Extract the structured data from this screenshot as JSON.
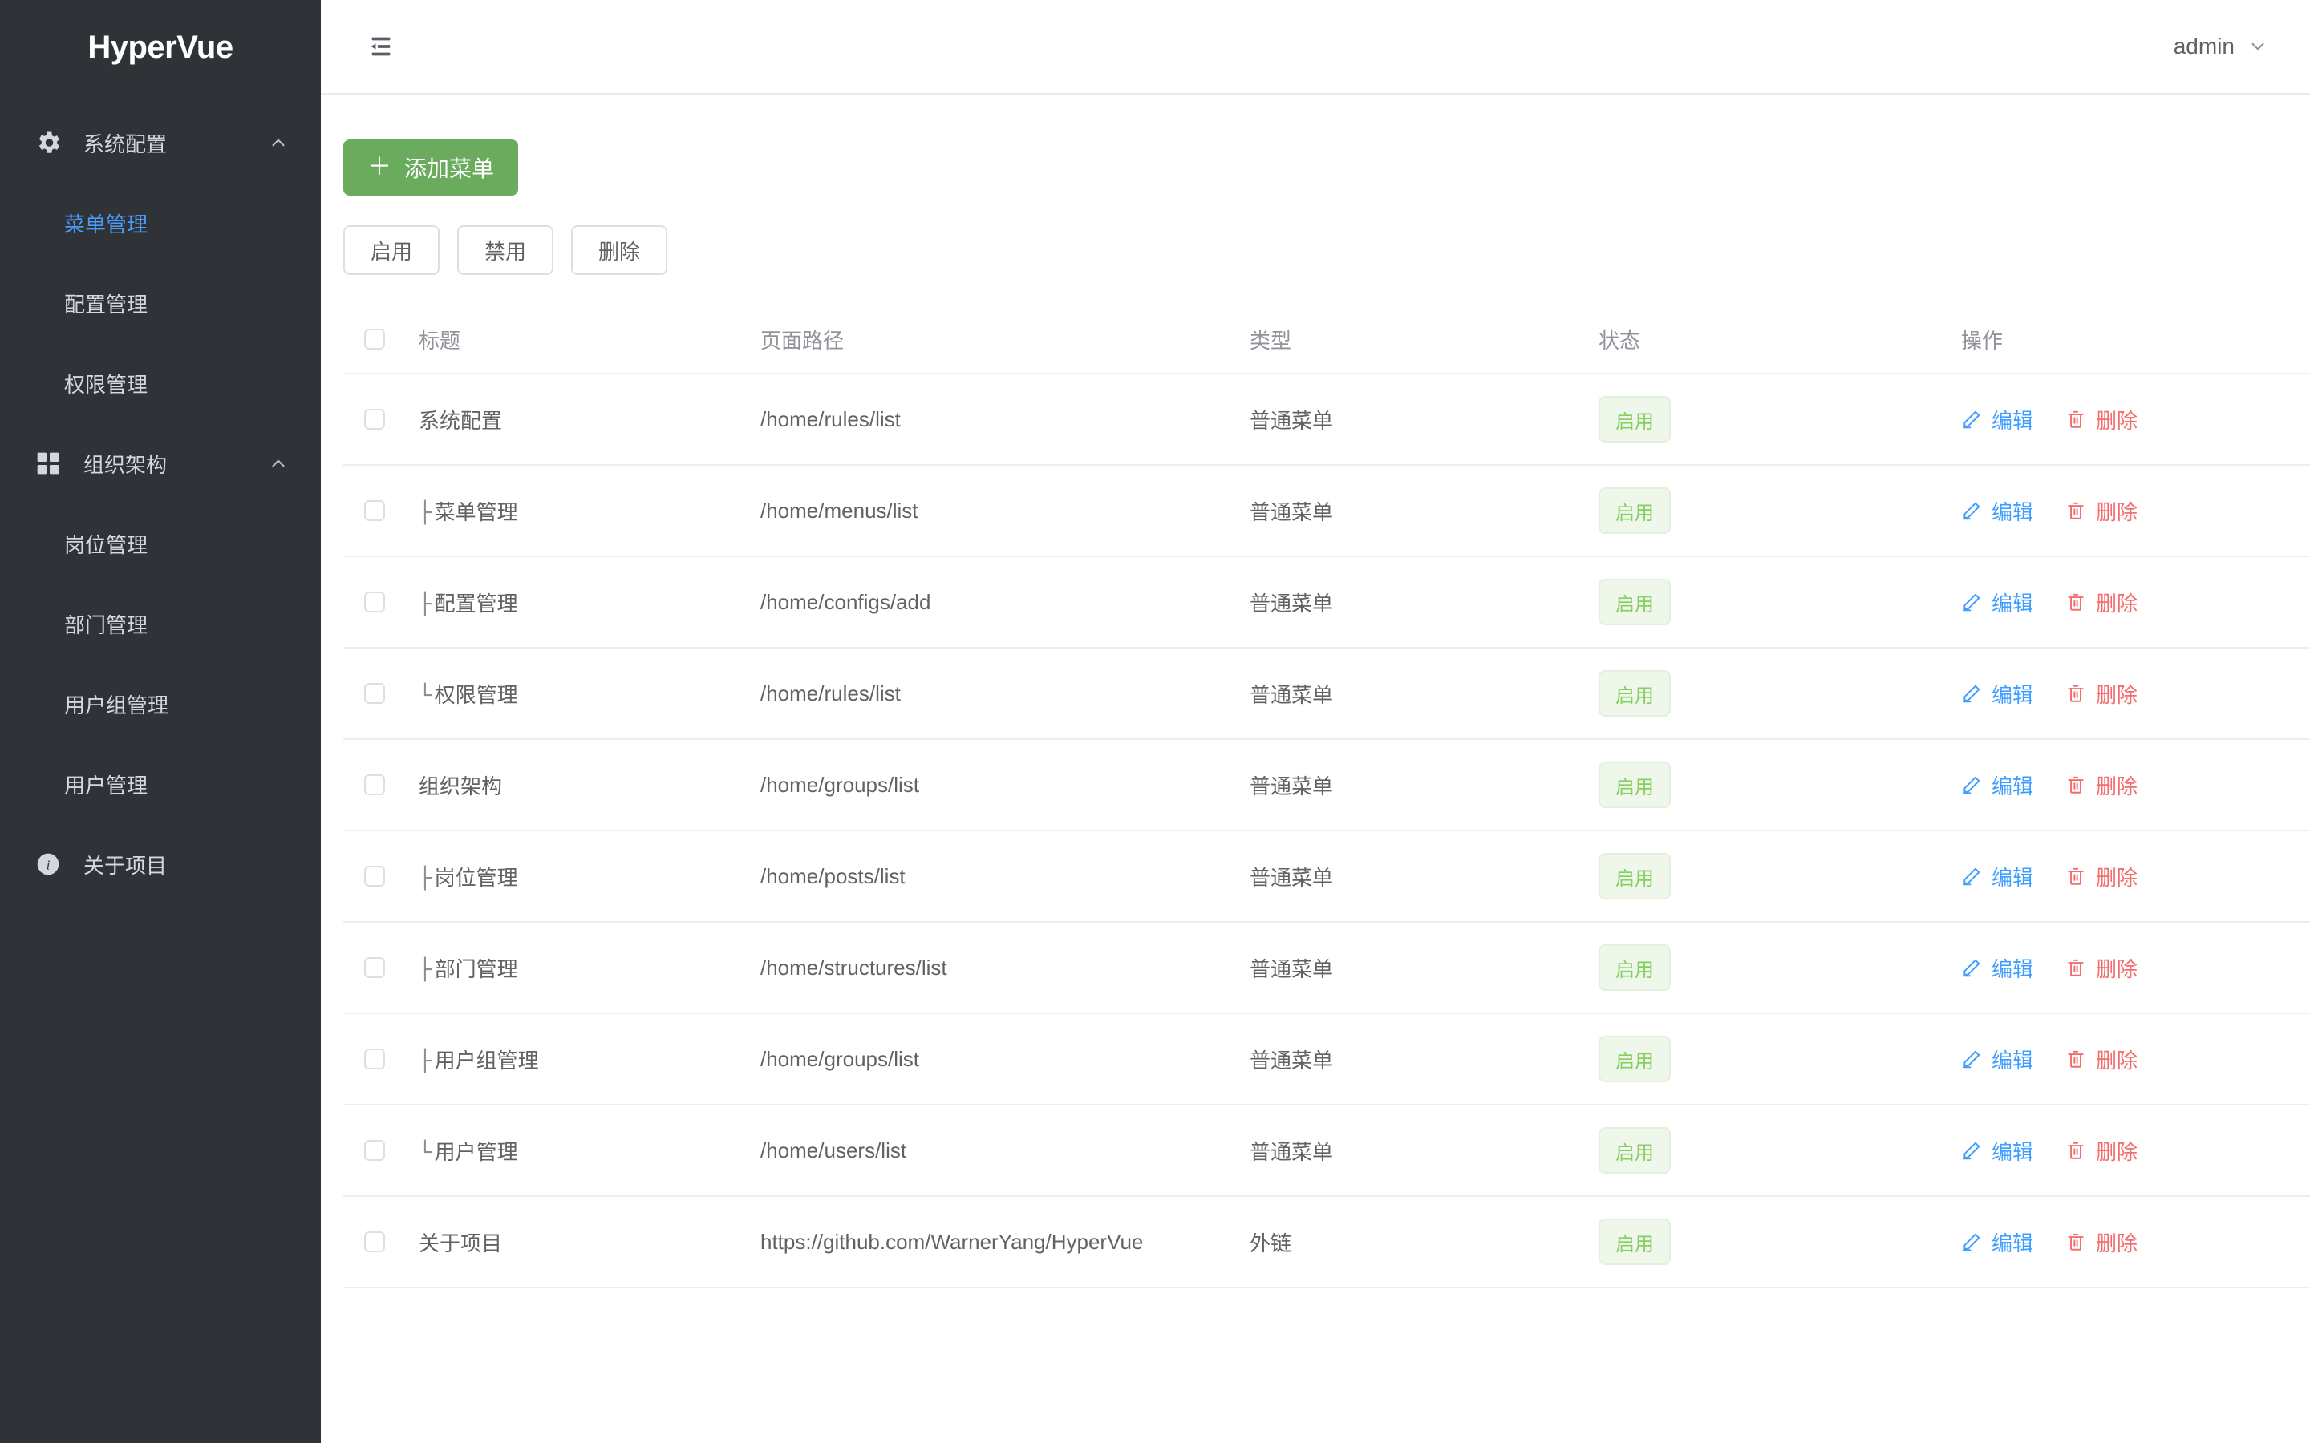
{
  "app": {
    "brand": "HyperVue"
  },
  "sidebar": {
    "groups": [
      {
        "label": "系统配置",
        "icon": "gear-icon",
        "expanded": true,
        "items": [
          {
            "label": "菜单管理",
            "active": true
          },
          {
            "label": "配置管理",
            "active": false
          },
          {
            "label": "权限管理",
            "active": false
          }
        ]
      },
      {
        "label": "组织架构",
        "icon": "grid-icon",
        "expanded": true,
        "items": [
          {
            "label": "岗位管理",
            "active": false
          },
          {
            "label": "部门管理",
            "active": false
          },
          {
            "label": "用户组管理",
            "active": false
          },
          {
            "label": "用户管理",
            "active": false
          }
        ]
      }
    ],
    "single": [
      {
        "label": "关于项目",
        "icon": "info-icon"
      }
    ]
  },
  "topbar": {
    "fold_icon": "fold-menu-icon",
    "user": "admin",
    "user_chevron": "chevron-down-icon"
  },
  "toolbar": {
    "add_label": "添加菜单",
    "add_plus": "＋",
    "enable_label": "启用",
    "disable_label": "禁用",
    "delete_label": "删除"
  },
  "table": {
    "columns": [
      "标题",
      "页面路径",
      "类型",
      "状态",
      "操作"
    ],
    "ops": {
      "edit": "编辑",
      "delete": "删除",
      "edit_icon": "pencil-icon",
      "delete_icon": "trash-icon"
    },
    "rows": [
      {
        "prefix": "",
        "title": "系统配置",
        "path": "/home/rules/list",
        "type": "普通菜单",
        "status": "启用"
      },
      {
        "prefix": "├",
        "title": "菜单管理",
        "path": "/home/menus/list",
        "type": "普通菜单",
        "status": "启用"
      },
      {
        "prefix": "├",
        "title": "配置管理",
        "path": "/home/configs/add",
        "type": "普通菜单",
        "status": "启用"
      },
      {
        "prefix": "└",
        "title": "权限管理",
        "path": "/home/rules/list",
        "type": "普通菜单",
        "status": "启用"
      },
      {
        "prefix": "",
        "title": "组织架构",
        "path": "/home/groups/list",
        "type": "普通菜单",
        "status": "启用"
      },
      {
        "prefix": "├",
        "title": "岗位管理",
        "path": "/home/posts/list",
        "type": "普通菜单",
        "status": "启用"
      },
      {
        "prefix": "├",
        "title": "部门管理",
        "path": "/home/structures/list",
        "type": "普通菜单",
        "status": "启用"
      },
      {
        "prefix": "├",
        "title": "用户组管理",
        "path": "/home/groups/list",
        "type": "普通菜单",
        "status": "启用"
      },
      {
        "prefix": "└",
        "title": "用户管理",
        "path": "/home/users/list",
        "type": "普通菜单",
        "status": "启用"
      },
      {
        "prefix": "",
        "title": "关于项目",
        "path": "https://github.com/WarnerYang/HyperVue",
        "type": "外链",
        "status": "启用"
      }
    ]
  },
  "colors": {
    "sidebar_bg": "#2f3337",
    "primary_green": "#6aab5e",
    "link_blue": "#409eff",
    "danger_red": "#f56c6c",
    "badge_green_text": "#85ce61",
    "badge_green_bg": "#eef7ea"
  }
}
